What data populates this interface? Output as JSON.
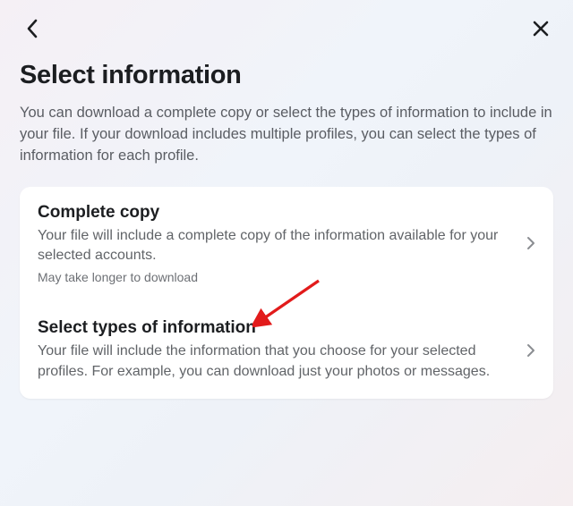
{
  "header": {
    "title": "Select information",
    "lead": "You can download a complete copy or select the types of information to include in your file. If your download includes multiple profiles, you can select the types of information for each profile."
  },
  "options": {
    "complete": {
      "title": "Complete copy",
      "desc": "Your file will include a complete copy of the information available for your selected accounts.",
      "note": "May take longer to download"
    },
    "select": {
      "title": "Select types of information",
      "desc": "Your file will include the information that you choose for your selected profiles. For example, you can download just your photos or messages."
    }
  }
}
